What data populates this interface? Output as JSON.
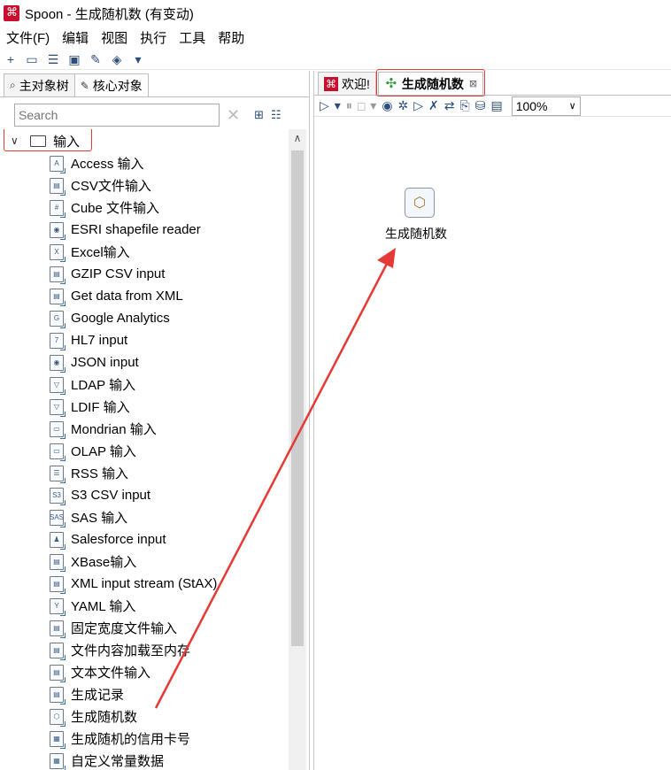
{
  "window": {
    "title": "Spoon - 生成随机数 (有变动)"
  },
  "menu": [
    "文件(F)",
    "编辑",
    "视图",
    "执行",
    "工具",
    "帮助"
  ],
  "left_tabs": [
    {
      "label": "主对象树",
      "icon": "tree-icon"
    },
    {
      "label": "核心对象",
      "icon": "pencil-icon"
    }
  ],
  "search": {
    "placeholder": "Search"
  },
  "tree": {
    "folder_label": "输入",
    "items": [
      "Access 输入",
      "CSV文件输入",
      "Cube 文件输入",
      "ESRI shapefile reader",
      "Excel输入",
      "GZIP CSV input",
      "Get data from XML",
      "Google Analytics",
      "HL7 input",
      "JSON input",
      "LDAP 输入",
      "LDIF 输入",
      "Mondrian 输入",
      "OLAP 输入",
      "RSS 输入",
      "S3 CSV input",
      "SAS 输入",
      "Salesforce input",
      "XBase输入",
      "XML input stream (StAX)",
      "YAML 输入",
      "固定宽度文件输入",
      "文件内容加载至内存",
      "文本文件输入",
      "生成记录",
      "生成随机数",
      "生成随机的信用卡号",
      "自定义常量数据"
    ],
    "selected_index": 25
  },
  "right_tabs": [
    {
      "label": "欢迎!"
    },
    {
      "label": "生成随机数"
    }
  ],
  "zoom": "100%",
  "canvas": {
    "step_label": "生成随机数"
  },
  "colors": {
    "highlight": "#e53935",
    "accent": "#2a4d7a"
  }
}
